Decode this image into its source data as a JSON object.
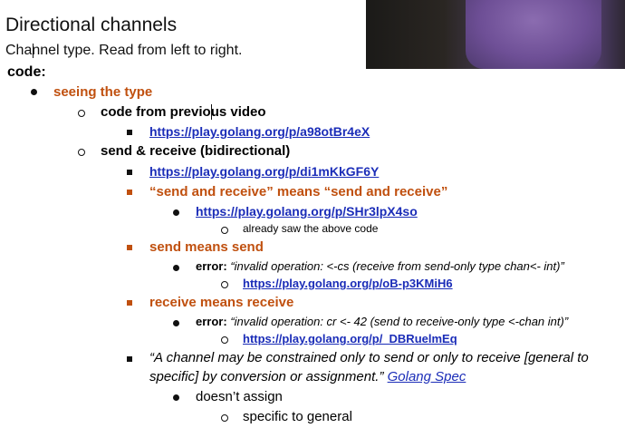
{
  "title": "Directional channels",
  "subtitle": "Channel type. Read from left to right.",
  "code_label": "code:",
  "l1_seeing": "seeing the type",
  "l2_code_prev": "code from previous video",
  "l3_link1": "https://play.golang.org/p/a98otBr4eX",
  "l2_send_receive": "send & receive (bidirectional)",
  "l3_link2": "https://play.golang.org/p/di1mKkGF6Y",
  "l3_send_and_receive": "“send and receive” means “send and receive”",
  "l4_link3": "https://play.golang.org/p/SHr3lpX4so",
  "l5_already_saw": "already saw the above code",
  "l3_send_means": "send means send",
  "l4_error1_label": "error:",
  "l4_error1_text": "“invalid operation: <-cs (receive from send-only type chan<- int)”",
  "l5_link4": "https://play.golang.org/p/oB-p3KMiH6",
  "l3_receive_means": "receive means receive",
  "l4_error2_label": "error:",
  "l4_error2_text": "“invalid operation: cr <- 42 (send to receive-only type <-chan int)”",
  "l5_link5": "https://play.golang.org/p/_DBRuelmEq",
  "l3_quote_line1": "“A channel may be constrained only to send or only to receive [general to",
  "l3_quote_line2": "specific] by conversion or assignment.”",
  "l3_spec_link": "Golang Spec",
  "l4_doesnt_assign": "doesn’t assign",
  "l5_specific_general": "specific to general",
  "colors": {
    "orange": "#c0500f",
    "link": "#1b2db8"
  }
}
